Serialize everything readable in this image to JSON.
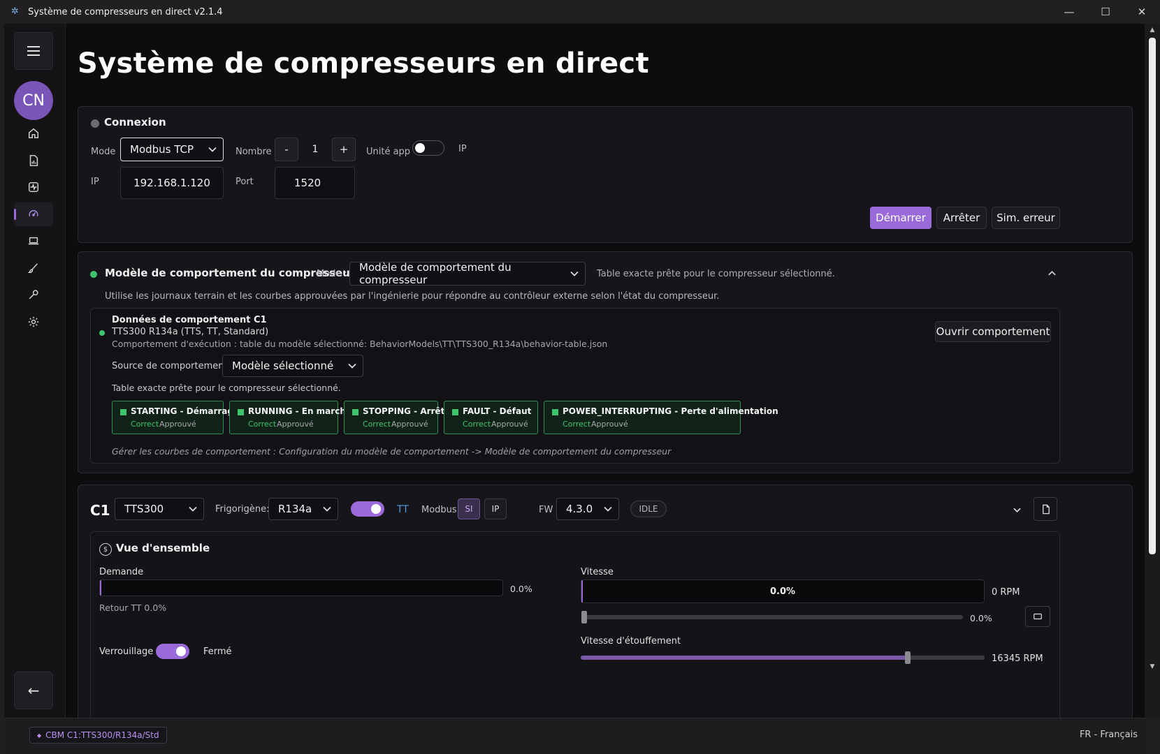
{
  "window": {
    "title": "Système de compresseurs en direct v2.1.4",
    "controls": [
      "—",
      "☐",
      "✕"
    ]
  },
  "sidebar": {
    "avatar": "CN",
    "items": [
      {
        "icon": "home-icon"
      },
      {
        "icon": "document-chart-icon"
      },
      {
        "icon": "pulse-icon"
      },
      {
        "icon": "gauge-icon",
        "active": true
      },
      {
        "icon": "laptop-icon"
      },
      {
        "icon": "brush-icon"
      },
      {
        "icon": "wrench-icon"
      },
      {
        "icon": "gear-icon"
      }
    ],
    "back_icon": "arrow-left-icon"
  },
  "page": {
    "title": "Système de compresseurs en direct"
  },
  "connection": {
    "heading": "Connexion",
    "mode_label": "Mode",
    "mode_value": "Modbus TCP",
    "count_label": "Nombre",
    "count_minus": "-",
    "count_value": "1",
    "count_plus": "+",
    "unit_label": "Unité app",
    "unit_toggle_on": false,
    "ip_toggle_label": "IP",
    "ip_label": "IP",
    "ip_value": "192.168.1.120",
    "port_label": "Port",
    "port_value": "1520",
    "start_label": "Démarrer",
    "stop_label": "Arrêter",
    "sim_error_label": "Sim. erreur"
  },
  "behavior": {
    "title": "Modèle de comportement du compresseur",
    "mode_label": "Mode :",
    "mode_value": "Modèle de comportement du compresseur",
    "ready_text": "Table exacte prête pour le compresseur sélectionné.",
    "description": "Utilise les journaux terrain et les courbes approuvées par l'ingénierie pour répondre au contrôleur externe selon l'état du compresseur.",
    "data_title": "Données de comportement C1",
    "data_model": "TTS300 R134a (TTS, TT, Standard)",
    "data_path": "Comportement d'exécution : table du modèle sélectionné: BehaviorModels\\TT\\TTS300_R134a\\behavior-table.json",
    "open_label": "Ouvrir comportement",
    "source_label": "Source de comportement :",
    "source_value": "Modèle sélectionné",
    "source_ready": "Table exacte prête pour le compresseur sélectionné.",
    "states": [
      {
        "name": "STARTING - Démarrage",
        "status": "Correct",
        "approval": "Approuvé"
      },
      {
        "name": "RUNNING - En marche",
        "status": "Correct",
        "approval": "Approuvé"
      },
      {
        "name": "STOPPING - Arrêt",
        "status": "Correct",
        "approval": "Approuvé"
      },
      {
        "name": "FAULT - Défaut",
        "status": "Correct",
        "approval": "Approuvé"
      },
      {
        "name": "POWER_INTERRUPTING - Perte d'alimentation",
        "status": "Correct",
        "approval": "Approuvé"
      }
    ],
    "footer": "Gérer les courbes de comportement : Configuration du modèle de comportement -> Modèle de comportement du compresseur"
  },
  "compressor": {
    "id": "C1",
    "model": "TTS300",
    "refrigerant_label": "Frigorigène:",
    "refrigerant": "R134a",
    "tt_label": "TT",
    "modbus_label": "Modbus",
    "si_label": "SI",
    "ip_label": "IP",
    "fw_label": "FW",
    "fw_value": "4.3.0",
    "state_badge": "IDLE",
    "overview": {
      "title": "Vue d'ensemble",
      "demand_label": "Demande",
      "demand_value": "0.0%",
      "demand_fraction": 0.0,
      "return_text": "Retour TT 0.0%",
      "lock_label": "Verrouillage",
      "lock_state": "Fermé",
      "speed_label": "Vitesse",
      "speed_bar_text": "0.0%",
      "speed_rpm": "0 RPM",
      "speed_slider_value": "0.0%",
      "speed_slider_fraction": 0.0,
      "choke_label": "Vitesse d'étouffement",
      "choke_rpm": "16345 RPM",
      "choke_fraction": 0.81
    }
  },
  "statusbar": {
    "chip": "CBM C1:TTS300/R134a/Std",
    "language": "FR - Français"
  },
  "colors": {
    "accent": "#9a6bd8",
    "ok": "#3ec46d",
    "background": "#0d0d10",
    "card": "#16161a"
  }
}
